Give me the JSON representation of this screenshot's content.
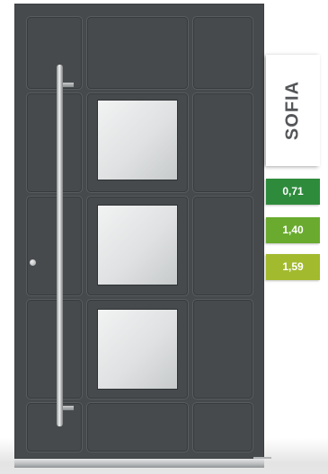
{
  "product": {
    "name": "SOFIA"
  },
  "ratings": [
    {
      "value": "0,71",
      "color": "#2e8b3c"
    },
    {
      "value": "1,40",
      "color": "#6aab2f"
    },
    {
      "value": "1,59",
      "color": "#a2ba2e"
    }
  ],
  "colors": {
    "door_panel": "#474a4c",
    "glass": "#e3e5e6",
    "handle": "#d9dbdc",
    "name_text": "#545659"
  }
}
